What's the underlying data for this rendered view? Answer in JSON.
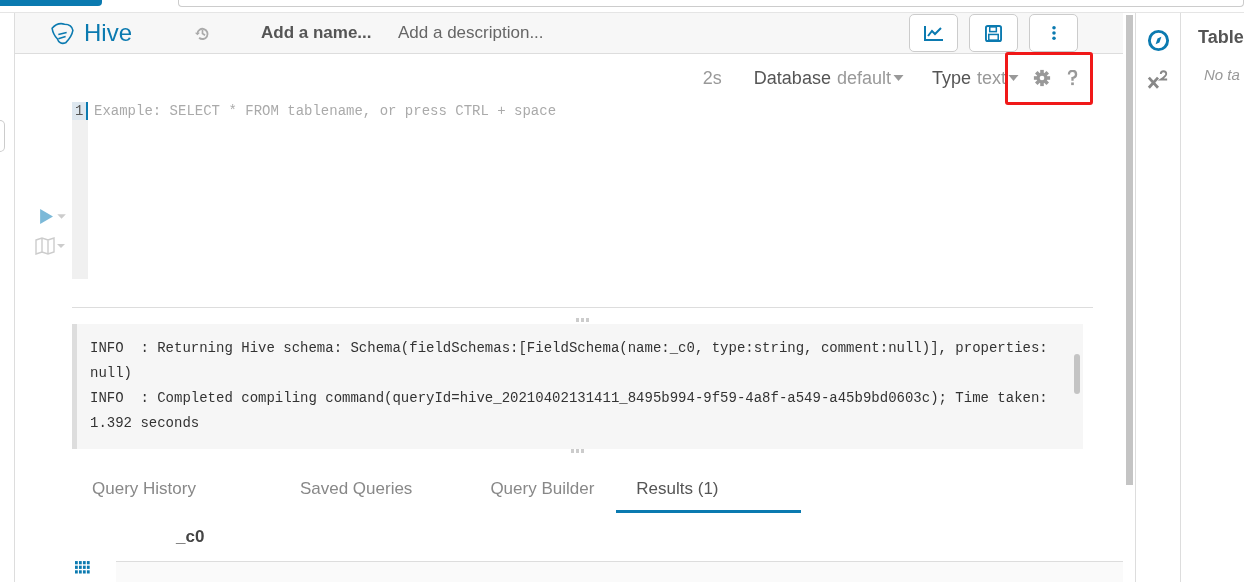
{
  "header": {
    "title": "Hive",
    "name_placeholder": "Add a name...",
    "description_placeholder": "Add a description..."
  },
  "editor": {
    "elapsed": "2s",
    "database_label": "Database",
    "database_value": "default",
    "type_label": "Type",
    "type_value": "text",
    "line_number": "1",
    "placeholder": "Example: SELECT * FROM tablename, or press CTRL + space"
  },
  "log_lines": [
    "INFO  : Returning Hive schema: Schema(fieldSchemas:[FieldSchema(name:_c0, type:string, comment:null)], properties: null)",
    "INFO  : Completed compiling command(queryId=hive_20210402131411_8495b994-9f59-4a8f-a549-a45b9bd0603c); Time taken: 1.392 seconds"
  ],
  "tabs": [
    {
      "label": "Query History",
      "selected": false
    },
    {
      "label": "Saved Queries",
      "selected": false
    },
    {
      "label": "Query Builder",
      "selected": false
    },
    {
      "label": "Results (1)",
      "selected": true
    }
  ],
  "results": {
    "columns": [
      "_c0"
    ]
  },
  "right_panel": {
    "title": "Table",
    "empty_text": "No ta"
  }
}
